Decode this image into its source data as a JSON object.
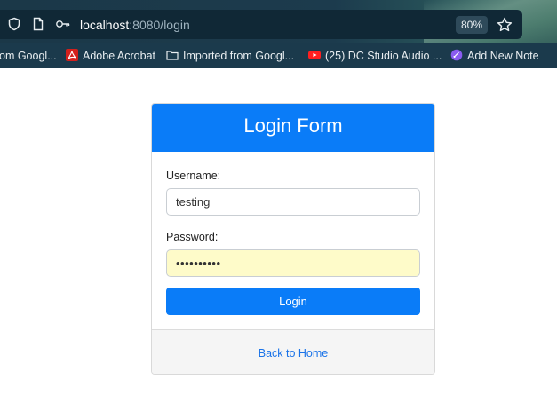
{
  "browser": {
    "url_host": "localhost",
    "url_path": ":8080/login",
    "zoom": "80%"
  },
  "bookmarks": [
    {
      "label": "om Googl...",
      "icon": "bookmark-icon"
    },
    {
      "label": "Adobe Acrobat",
      "icon": "acrobat-icon"
    },
    {
      "label": "Imported from Googl...",
      "icon": "folder-icon"
    },
    {
      "label": "(25) DC Studio Audio ...",
      "icon": "youtube-icon"
    },
    {
      "label": "Add New Note",
      "icon": "note-icon"
    }
  ],
  "login": {
    "title": "Login Form",
    "username_label": "Username:",
    "username_value": "testing",
    "password_label": "Password:",
    "password_value": "••••••••••",
    "submit_label": "Login",
    "back_link": "Back to Home"
  },
  "colors": {
    "primary": "#0a7cf8",
    "autofill": "#fefbc9",
    "link": "#1a73e8"
  }
}
